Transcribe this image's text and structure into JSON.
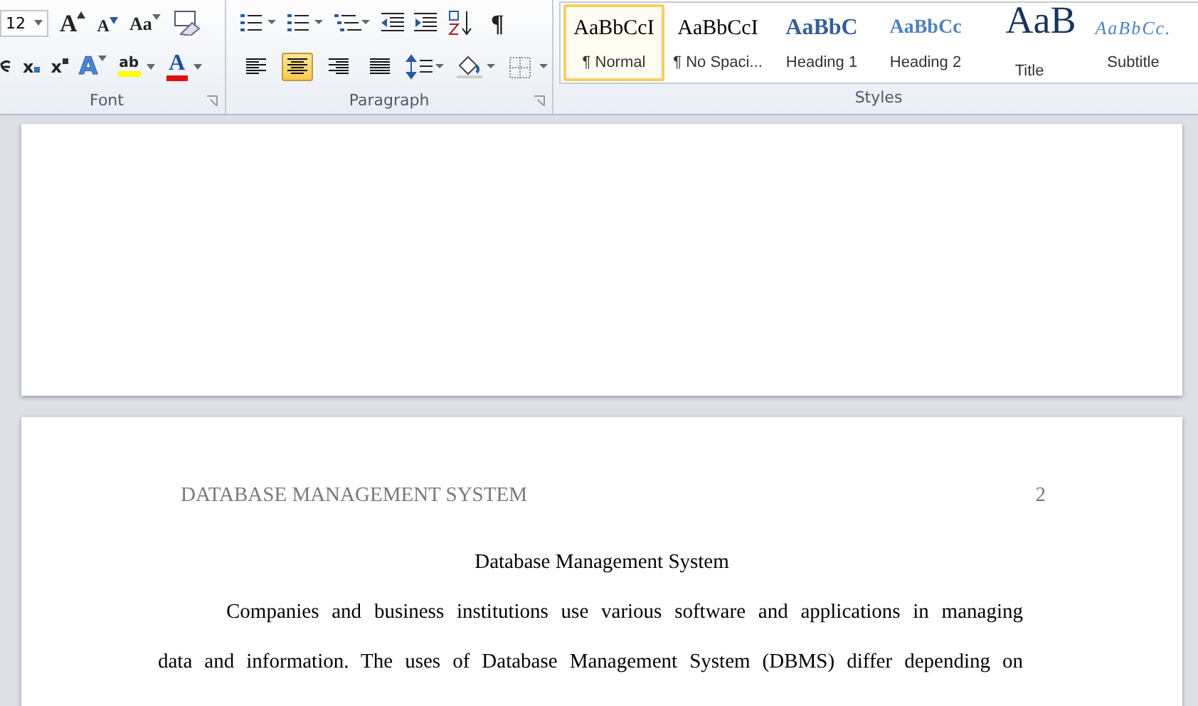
{
  "ribbon": {
    "font": {
      "label": "Font",
      "size": "12",
      "row1": [
        {
          "kind": "grow",
          "glyph": "A"
        },
        {
          "kind": "shrink",
          "glyph": "A"
        },
        {
          "kind": "case",
          "glyph": "Aa"
        },
        {
          "kind": "clear"
        }
      ],
      "row2": [
        {
          "kind": "sub",
          "glyph": "x"
        },
        {
          "kind": "sup",
          "glyph": "x"
        },
        {
          "kind": "effects",
          "glyph": "A"
        },
        {
          "kind": "highlight",
          "glyph": "ab"
        },
        {
          "kind": "color",
          "glyph": "A"
        }
      ]
    },
    "paragraph": {
      "label": "Paragraph",
      "row1": [
        {
          "kind": "bullets"
        },
        {
          "kind": "numbering"
        },
        {
          "kind": "multilevel"
        },
        {
          "kind": "outdent"
        },
        {
          "kind": "indent"
        },
        {
          "kind": "sort"
        },
        {
          "kind": "pilcrow",
          "glyph": "¶"
        }
      ],
      "align": [
        {
          "kind": "left",
          "selected": false
        },
        {
          "kind": "center",
          "selected": true
        },
        {
          "kind": "right",
          "selected": false
        },
        {
          "kind": "justify",
          "selected": false
        }
      ],
      "row2": [
        {
          "kind": "spacing"
        },
        {
          "kind": "shading"
        },
        {
          "kind": "borders"
        }
      ]
    },
    "styles": {
      "label": "Styles",
      "items": [
        {
          "sample": "AaBbCcI",
          "name": "¶ Normal",
          "kind": "normal",
          "selected": true
        },
        {
          "sample": "AaBbCcI",
          "name": "¶ No Spaci...",
          "kind": "normal",
          "selected": false
        },
        {
          "sample": "AaBbC",
          "name": "Heading 1",
          "kind": "h1",
          "selected": false
        },
        {
          "sample": "AaBbCc",
          "name": "Heading 2",
          "kind": "h2",
          "selected": false
        },
        {
          "sample": "AaB",
          "name": "Title",
          "kind": "title",
          "selected": false
        },
        {
          "sample": "AaBbCc.",
          "name": "Subtitle",
          "kind": "subtitle",
          "selected": false
        }
      ]
    }
  },
  "page2": {
    "header": "DATABASE MANAGEMENT SYSTEM",
    "page_number": "2",
    "title": "Database Management System",
    "lines": [
      "Companies and business institutions use various software and applications in managing",
      "data and information. The uses of Database Management System (DBMS) differ depending on"
    ]
  }
}
